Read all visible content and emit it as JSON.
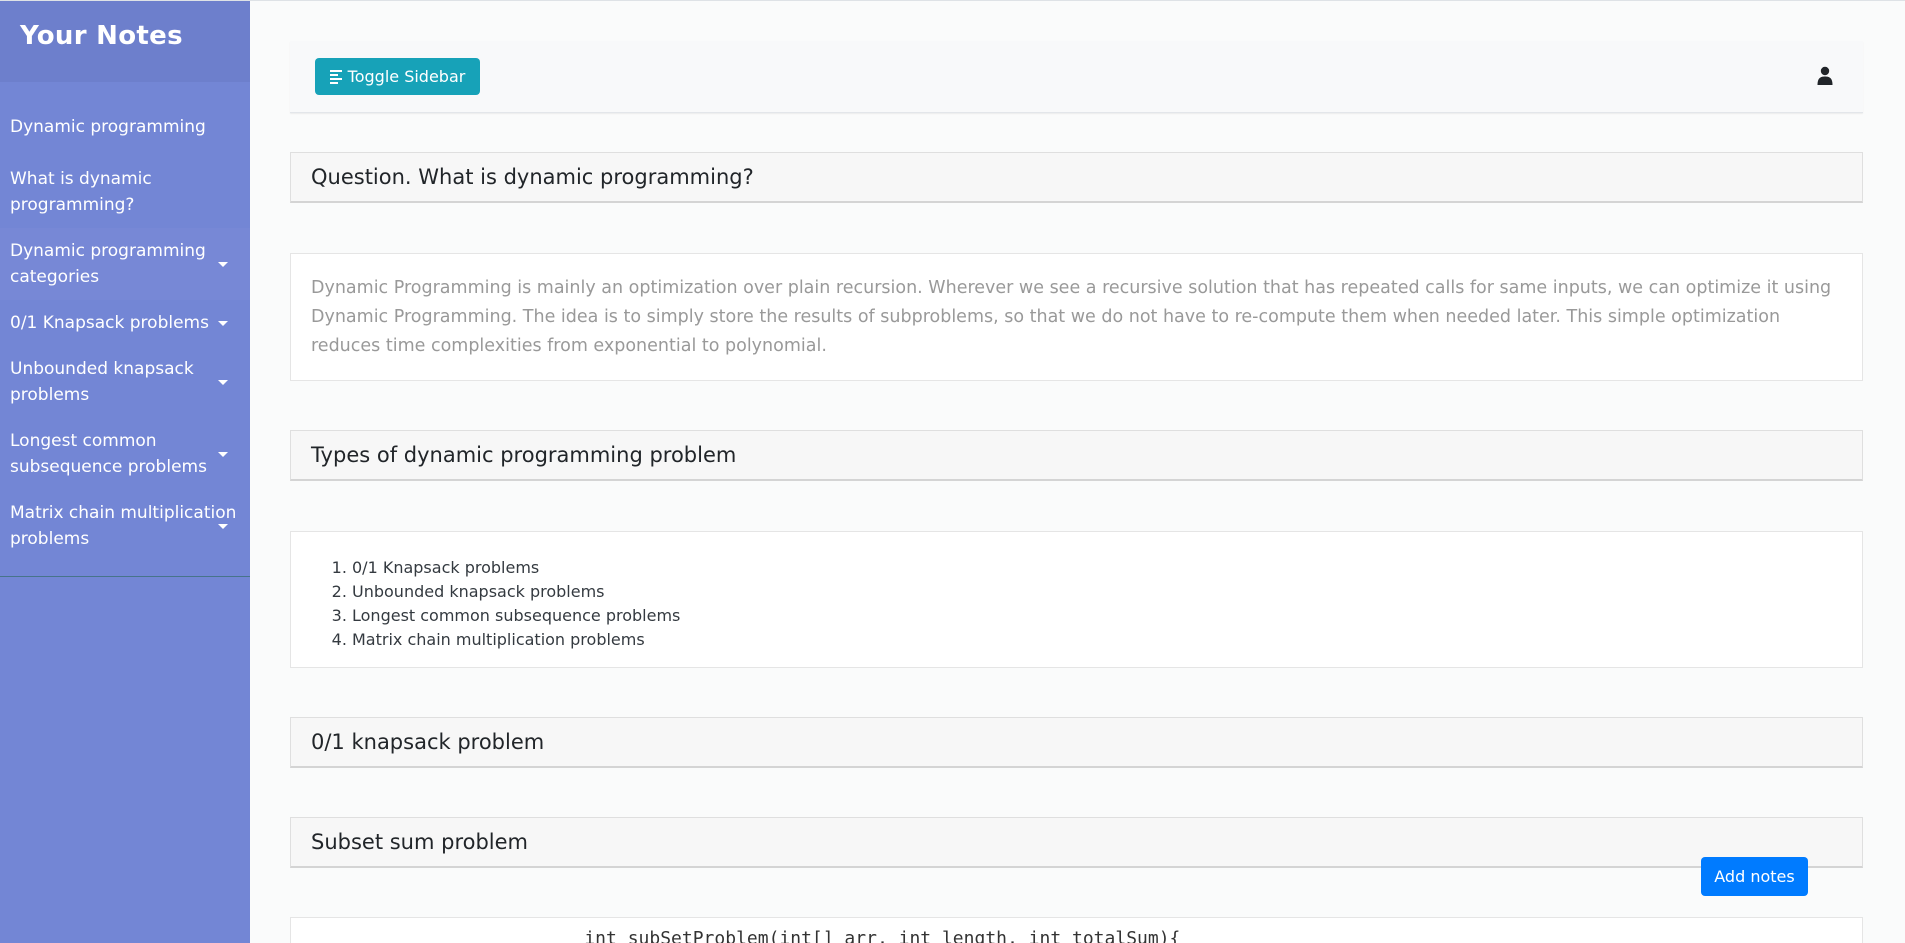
{
  "sidebar": {
    "title": "Your Notes",
    "items": [
      {
        "label": "Dynamic programming"
      },
      {
        "label": "What is dynamic programming?"
      },
      {
        "label": "Dynamic programming categories"
      },
      {
        "label": "0/1 Knapsack problems"
      },
      {
        "label": "Unbounded knapsack problems"
      },
      {
        "label": "Longest common subsequence problems"
      },
      {
        "label": "Matrix chain multiplication problems"
      }
    ]
  },
  "navbar": {
    "toggle_label": "Toggle Sidebar"
  },
  "sections": {
    "question_title": "Question. What is dynamic programming?",
    "question_answer": "Dynamic Programming is mainly an optimization over plain recursion. Wherever we see a recursive solution that has repeated calls for same inputs, we can optimize it using Dynamic Programming. The idea is to simply store the results of subproblems, so that we do not have to re-compute them when needed later. This simple optimization reduces time complexities from exponential to polynomial.",
    "types_title": "Types of dynamic programming problem",
    "types_list": [
      "0/1 Knapsack problems",
      "Unbounded knapsack problems",
      "Longest common subsequence problems",
      "Matrix chain multiplication problems"
    ],
    "knapsack_title": "0/1 knapsack problem",
    "subset_title": "Subset sum problem",
    "code_partial": "    int subSetProblem(int[] arr, int length, int totalSum){"
  },
  "add_notes_label": "Add notes"
}
